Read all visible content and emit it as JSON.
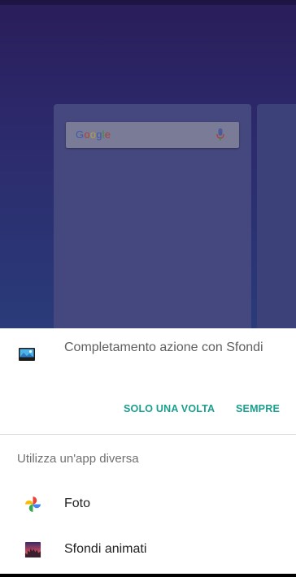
{
  "launcher": {
    "search_logo_letters": [
      "G",
      "o",
      "o",
      "g",
      "l",
      "e"
    ],
    "search_mic_icon": "mic-icon"
  },
  "chooser": {
    "title": "Completamento azione con Sfondi",
    "app_icon": "wallpaper-app-icon",
    "actions": {
      "once_label": "SOLO UNA VOLTA",
      "always_label": "SEMPRE"
    },
    "other_app_label": "Utilizza un'app diversa",
    "apps": [
      {
        "label": "Foto",
        "icon": "google-photos-icon"
      },
      {
        "label": "Sfondi animati",
        "icon": "live-wallpapers-icon"
      }
    ]
  },
  "colors": {
    "accent": "#1a9e8e",
    "sheet_background": "#ffffff",
    "launcher_dim": "#2c2a6c"
  }
}
